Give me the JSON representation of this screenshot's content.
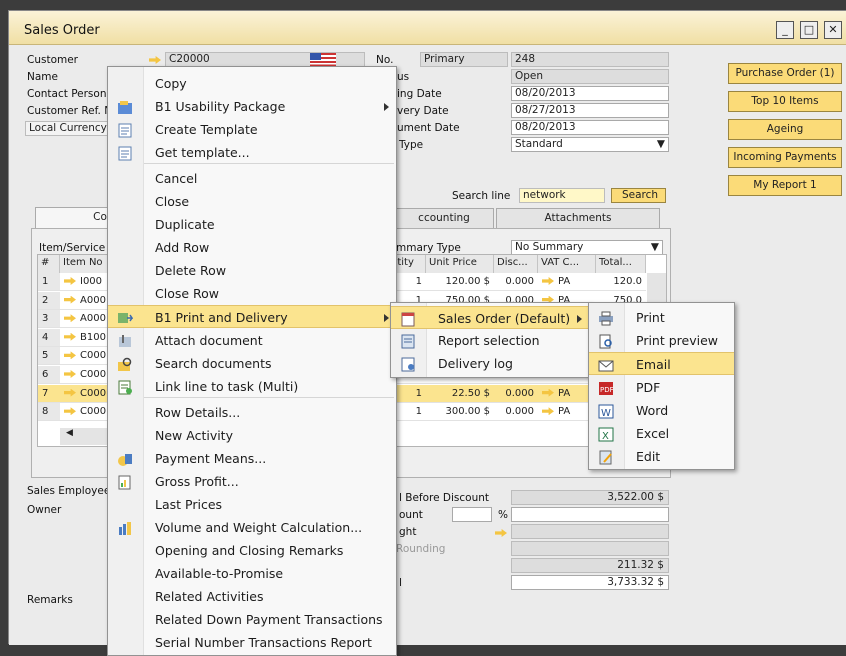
{
  "window": {
    "title": "Sales Order"
  },
  "header": {
    "customer_label": "Customer",
    "customer_value": "C20000",
    "name_label": "Name",
    "contact_label": "Contact Person",
    "custref_label": "Customer Ref. No.",
    "currency_label": "Local Currency",
    "no_label": "No.",
    "no_series": "Primary",
    "no_value": "248",
    "status_label": "us",
    "status_value": "Open",
    "posting_label": "ing Date",
    "posting_value": "08/20/2013",
    "delivery_label": "very Date",
    "delivery_value": "08/27/2013",
    "document_label": "ument Date",
    "document_value": "08/20/2013",
    "type_label": "Type",
    "type_value": "Standard",
    "search_line_label": "Search line",
    "search_line_value": "network",
    "search_button": "Search"
  },
  "side_buttons": [
    "Purchase Order (1)",
    "Top 10 Items",
    "Ageing",
    "Incoming Payments",
    "My Report 1"
  ],
  "tabs": {
    "contents": "Co",
    "accounting": "ccounting",
    "attachments": "Attachments"
  },
  "grid": {
    "item_label": "Item/Service",
    "summary_type_label": "mmary Type",
    "summary_type_value": "No Summary",
    "columns": [
      "#",
      "Item No",
      "ntity",
      "Unit Price",
      "Disc...",
      "VAT C...",
      "Total..."
    ],
    "rows": [
      {
        "n": "1",
        "item": "I000",
        "qty": "1",
        "price": "120.00 $",
        "disc": "0.000",
        "vat": "PA",
        "total": "120.0"
      },
      {
        "n": "2",
        "item": "A000",
        "qty": "1",
        "price": "750.00 $",
        "disc": "0.000",
        "vat": "PA",
        "total": "750.0"
      },
      {
        "n": "3",
        "item": "A000",
        "qty": "",
        "price": "",
        "disc": "",
        "vat": "",
        "total": ""
      },
      {
        "n": "4",
        "item": "B100",
        "qty": "",
        "price": "",
        "disc": "",
        "vat": "",
        "total": ""
      },
      {
        "n": "5",
        "item": "C000",
        "qty": "",
        "price": "",
        "disc": "",
        "vat": "",
        "total": ""
      },
      {
        "n": "6",
        "item": "C000",
        "qty": "",
        "price": "",
        "disc": "",
        "vat": "",
        "total": ""
      },
      {
        "n": "7",
        "item": "C000",
        "qty": "1",
        "price": "22.50 $",
        "disc": "0.000",
        "vat": "PA",
        "total": ""
      },
      {
        "n": "8",
        "item": "C000",
        "qty": "1",
        "price": "300.00 $",
        "disc": "0.000",
        "vat": "PA",
        "total": ""
      }
    ]
  },
  "footer": {
    "employee_label": "Sales Employee",
    "owner_label": "Owner",
    "remarks_label": "Remarks",
    "before_discount_label": "l Before Discount",
    "before_discount_value": "3,522.00 $",
    "discount_label": "ount",
    "percent": "%",
    "freight_label": "ght",
    "rounding_label": "Rounding",
    "tax_value": "211.32 $",
    "total_label": "l",
    "total_value": "3,733.32 $"
  },
  "context_menu": {
    "items": [
      "Copy",
      "B1 Usability Package",
      "Create Template",
      "Get template...",
      "Cancel",
      "Close",
      "Duplicate",
      "Add Row",
      "Delete Row",
      "Close Row",
      "B1 Print and Delivery",
      "Attach document",
      "Search documents",
      "Link line to task (Multi)",
      "Row Details...",
      "New Activity",
      "Payment Means...",
      "Gross Profit...",
      "Last Prices",
      "Volume and Weight Calculation...",
      "Opening and Closing Remarks",
      "Available-to-Promise",
      "Related Activities",
      "Related Down Payment Transactions",
      "Serial Number Transactions Report"
    ]
  },
  "print_menu": {
    "items": [
      "Sales Order (Default)",
      "Report selection",
      "Delivery log"
    ]
  },
  "output_menu": {
    "items": [
      "Print",
      "Print preview",
      "Email",
      "PDF",
      "Word",
      "Excel",
      "Edit"
    ]
  },
  "colors": {
    "highlight": "#fbe48f",
    "button_yellow": "#fbdb78",
    "titlebar": "#f0dfa4"
  }
}
